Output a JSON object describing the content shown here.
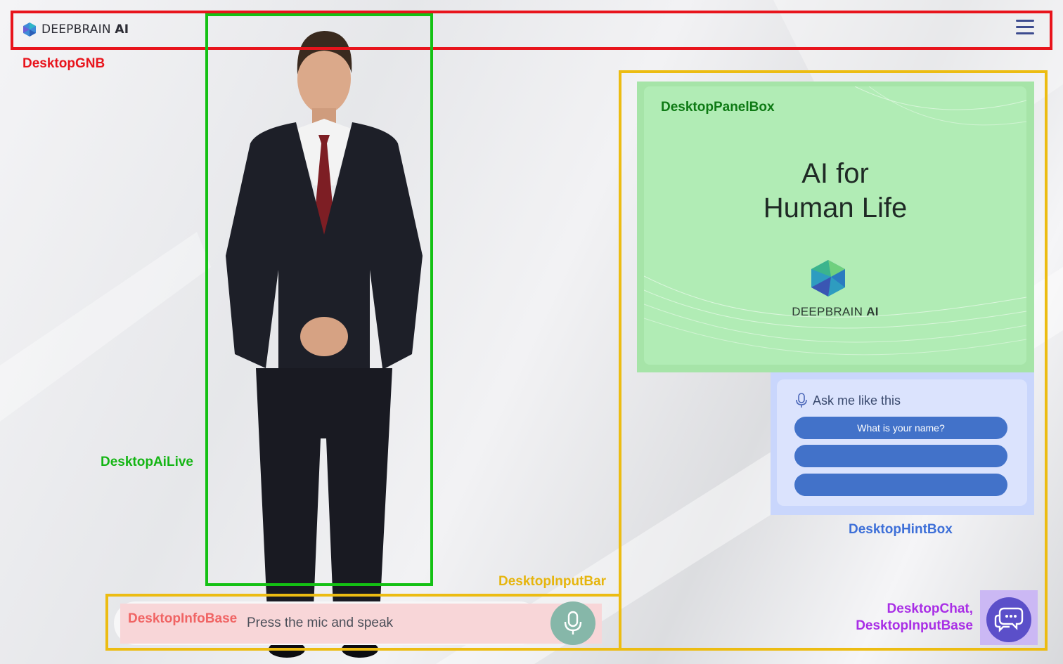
{
  "header": {
    "logo_name": "DEEPBRAIN",
    "logo_suffix": "AI",
    "menu_icon": "hamburger-menu-icon"
  },
  "annotations": {
    "gnb": "DesktopGNB",
    "ai_live": "DesktopAiLive",
    "panel_box": "DesktopPanelBox",
    "hint_box": "DesktopHintBox",
    "input_bar": "DesktopInputBar",
    "info_base": "DesktopInfoBase",
    "chat_line1": "DesktopChat,",
    "chat_line2": "DesktopInputBase"
  },
  "panel": {
    "title_line1": "AI for",
    "title_line2": "Human Life",
    "brand_name": "DEEPBRAIN",
    "brand_suffix": "AI"
  },
  "hint": {
    "title": "Ask me like this",
    "items": [
      "What is your name?",
      "",
      ""
    ]
  },
  "input": {
    "info_text": "Press the mic and speak",
    "mic_icon": "microphone-icon"
  },
  "chat": {
    "icon": "chat-bubbles-icon"
  },
  "colors": {
    "annotation_red": "#e8141c",
    "annotation_green": "#14c114",
    "annotation_yellow": "#ecbc12",
    "annotation_blue": "#3d6fd8",
    "annotation_purple": "#a92ee6",
    "annotation_pink": "#f06464",
    "hint_pill": "#4272c9",
    "mic_button": "#86b7a9",
    "chat_button": "#5b4fc9"
  }
}
